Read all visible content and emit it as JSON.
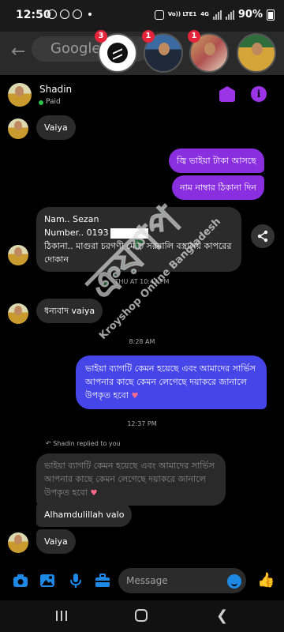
{
  "status_bar": {
    "time": "12:50",
    "network_label": "Vo)) LTE1",
    "network_type": "4G",
    "battery": "90%"
  },
  "browser_overlay": {
    "search_label": "Google"
  },
  "chat_heads": [
    {
      "kind": "messenger",
      "badge": "3"
    },
    {
      "kind": "contact",
      "badge": "1"
    },
    {
      "kind": "contact",
      "badge": "1"
    },
    {
      "kind": "contact",
      "badge": ""
    }
  ],
  "header": {
    "name": "Shadin",
    "status": "Paid"
  },
  "messages": [
    {
      "dir": "in",
      "text": "Vaiya"
    },
    {
      "dir": "out",
      "text": "জ্বি ভাইয়া টাকা আসছে"
    },
    {
      "dir": "out",
      "text": "নাম নাম্বার ঠিকানা দিন"
    },
    {
      "dir": "in",
      "line1": "Nam.. Sezan",
      "line2": "Number.. 0193",
      "line3": "ঠিকানা.. মাগুরা চরগণী মোড় সরনালি বস্ত্রালয় কাপরের দোকান"
    },
    {
      "dir": "in",
      "text": "ধন্যবাদ vaiya"
    },
    {
      "dir": "out",
      "text": "ভাইয়া ব্যাগটি কেমন হয়েছে এবং আমাদের সার্ভিস আপনার কাছে কেমন লেগেছে দয়াকরে জানালে উপকৃত হবো"
    },
    {
      "dir": "in",
      "quoted": true,
      "text": "ভাইয়া ব্যাগটি কেমন হয়েছে এবং আমাদের সার্ভিস আপনার কাছে কেমন লেগেছে দয়াকরে জানালে উপকৃত হবো"
    },
    {
      "dir": "in",
      "text": "Alhamdulillah valo"
    },
    {
      "dir": "in",
      "text": "Vaiya"
    }
  ],
  "timestamps": {
    "t1": "THU AT 10:42 PM",
    "t2": "8:28 AM",
    "t3": "12:37 PM"
  },
  "reply_note": "Shadin replied to you",
  "watermark": {
    "main": "ক্রয়শপ",
    "sub": "Kroyshop Online Bangladesh"
  },
  "composer": {
    "placeholder": "Message"
  },
  "colors": {
    "accent": "#8a2fe0",
    "blue": "#4645e8",
    "online": "#2fc24c",
    "badge": "#e4243b"
  },
  "icons": [
    "camera-icon",
    "image-icon",
    "mic-icon",
    "briefcase-icon",
    "emoji-icon",
    "thumbs-up-icon",
    "share-icon",
    "info-icon",
    "tag-icon"
  ]
}
